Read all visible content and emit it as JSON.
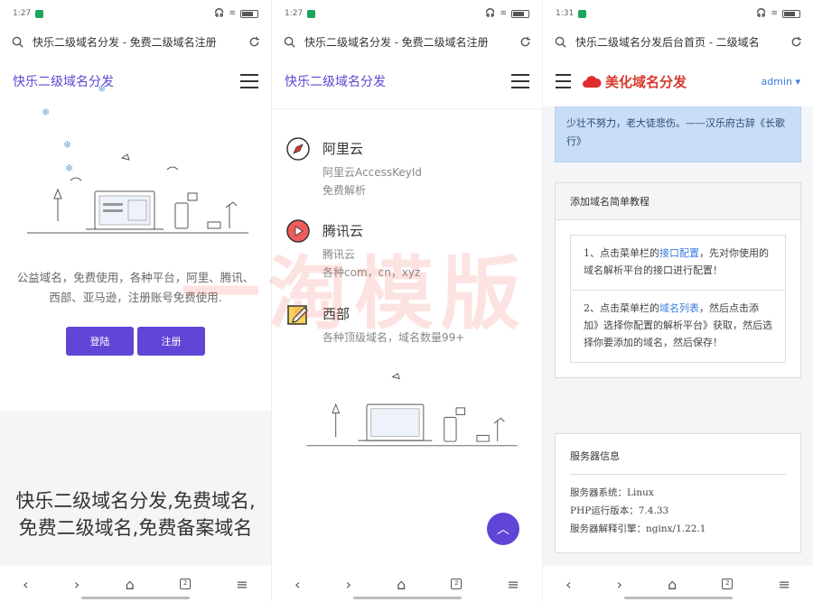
{
  "status_bar": {
    "time_1": "1:27",
    "time_2": "1:27",
    "time_3": "1:31"
  },
  "panel1": {
    "url": "快乐二级域名分发 - 免费二级域名注册",
    "brand": "快乐二级域名分发",
    "description": "公益域名，免费使用，各种平台，阿里、腾讯、西部、亚马逊，注册账号免费使用.",
    "login_label": "登陆",
    "register_label": "注册",
    "headline": "快乐二级域名分发,免费域名,免费二级域名,免费备案域名"
  },
  "panel2": {
    "url": "快乐二级域名分发 - 免费二级域名注册",
    "brand": "快乐二级域名分发",
    "services": [
      {
        "title": "阿里云",
        "line1": "阿里云AccessKeyId",
        "line2": "免费解析"
      },
      {
        "title": "腾讯云",
        "line1": "腾讯云",
        "line2": "各种com，cn，xyz"
      },
      {
        "title": "西部",
        "line1": "各种顶级域名，域名数量99+"
      }
    ]
  },
  "panel3": {
    "url": "快乐二级域名分发后台首页 - 二级域名",
    "logo": "美化域名分发",
    "admin_label": "admin",
    "quote": "少壮不努力，老大徒悲伤。——汉乐府古辞《长歌行》",
    "tutorial_title": "添加域名简单教程",
    "step1_pre": "1、点击菜单栏的",
    "step1_link": "接口配置",
    "step1_post": "，先对你使用的域名解析平台的接口进行配置！",
    "step2_pre": "2、点击菜单栏的",
    "step2_link": "域名列表",
    "step2_post": "，然后点击添加》选择你配置的解析平台》获取，然后选择你要添加的域名，然后保存！",
    "server_title": "服务器信息",
    "server_os": "服务器系统：Linux",
    "php_version": "PHP运行版本：7.4.33",
    "server_engine": "服务器解释引擎：nginx/1.22.1"
  },
  "watermark": "一淘模版",
  "colors": {
    "accent": "#6045d6",
    "brand_text": "#5b4ad0",
    "logo_red": "#d83a2e",
    "alert_bg": "#c9ddf7",
    "link": "#3a7be0"
  }
}
